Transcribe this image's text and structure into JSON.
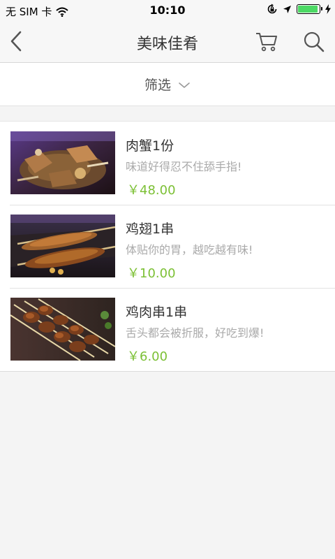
{
  "status_bar": {
    "carrier": "无 SIM 卡",
    "time": "10:10",
    "battery_level": 0.95
  },
  "nav": {
    "title": "美味佳肴",
    "back_icon": "chevron-left-icon",
    "cart_icon": "cart-icon",
    "search_icon": "search-icon"
  },
  "filter": {
    "label": "筛选"
  },
  "items": [
    {
      "name": "肉蟹1份",
      "desc": "味道好得忍不住舔手指!",
      "price": "￥48.00"
    },
    {
      "name": "鸡翅1串",
      "desc": "体贴你的胃，越吃越有味!",
      "price": "￥10.00"
    },
    {
      "name": "鸡肉串1串",
      "desc": "舌头都会被折服，好吃到爆!",
      "price": "￥6.00"
    }
  ],
  "colors": {
    "price": "#7cc035",
    "battery": "#4cd964"
  }
}
